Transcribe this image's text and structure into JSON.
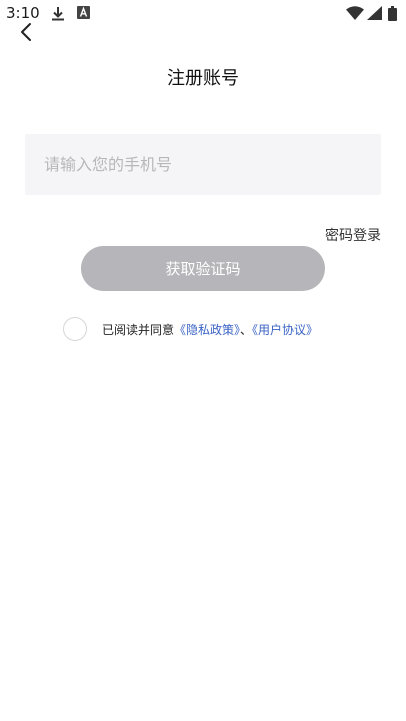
{
  "status_bar": {
    "time": "3:10",
    "icons": [
      "download-icon",
      "a-letter-icon",
      "wifi-icon",
      "signal-icon",
      "battery-icon"
    ]
  },
  "header": {
    "back_icon": "chevron-left-icon",
    "title": "注册账号"
  },
  "phone_input": {
    "placeholder": "请输入您的手机号",
    "value": ""
  },
  "password_login_label": "密码登录",
  "get_code_button": {
    "label": "获取验证码",
    "color": "#b5b5ba"
  },
  "agreement": {
    "checked": false,
    "prefix": "已阅读并同意",
    "privacy_link": "《隐私政策》",
    "separator": "、",
    "user_link": "《用户协议》",
    "link_color": "#3a63c4"
  }
}
